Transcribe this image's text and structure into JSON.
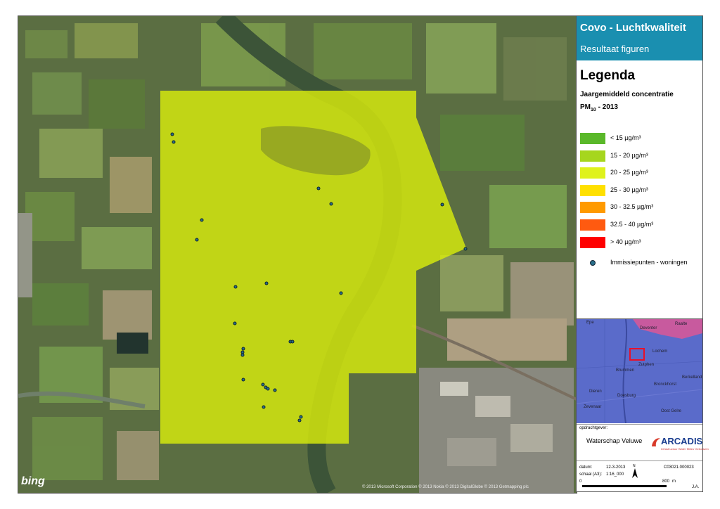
{
  "panel": {
    "title": "Covo - Luchtkwaliteit",
    "subtitle": "Resultaat figuren",
    "legend_heading": "Legenda",
    "legend_line1": "Jaargemiddeld concentratie",
    "legend_pm": "PM",
    "legend_pm_sub": "10",
    "legend_year": " - 2013",
    "legend_items": [
      {
        "label": "< 15 µg/m³",
        "color": "#5ab82a"
      },
      {
        "label": "15 - 20 µg/m³",
        "color": "#a6d61e"
      },
      {
        "label": "20 - 25 µg/m³",
        "color": "#dff21c"
      },
      {
        "label": "25 - 30 µg/m³",
        "color": "#ffe000"
      },
      {
        "label": "30 - 32.5 µg/m³",
        "color": "#ff9a00"
      },
      {
        "label": "32.5 - 40 µg/m³",
        "color": "#ff5a10"
      },
      {
        "label": "> 40 µg/m³",
        "color": "#ff0000"
      }
    ],
    "points_label": "Immissiepunten - woningen",
    "inset_places": [
      "Epe",
      "Deventer",
      "Raalte",
      "Lochem",
      "Zutphen",
      "Brummen",
      "Berkelland",
      "Dieren",
      "Doesburg",
      "Bronckhorst",
      "Zevenaar",
      "Oost Gelre"
    ],
    "client_label": "opdrachtgever:",
    "client_name": "Waterschap Veluwe",
    "logo_name": "ARCADIS",
    "logo_tagline": "Infrastructuur·Water·Milieu·Gebouwen",
    "date_label": "datum:",
    "date_value": "12-3-2013",
    "scale_label": "schaal (A3):",
    "scale_value": "1:16_000",
    "project_code": "C03021.000023",
    "north": "N",
    "scale_start": "0",
    "scale_end": "800",
    "scale_unit": "m",
    "author": "J.A."
  },
  "map": {
    "provider": "bing",
    "copyright": "© 2013 Microsoft Corporation © 2013 Nokia © 2013 DigitalGlobe © 2013 Getmapping plc"
  },
  "colors": {
    "overlay": "#d8ec0c",
    "river": "#3c5438",
    "title_bar": "#1a8fb0"
  }
}
